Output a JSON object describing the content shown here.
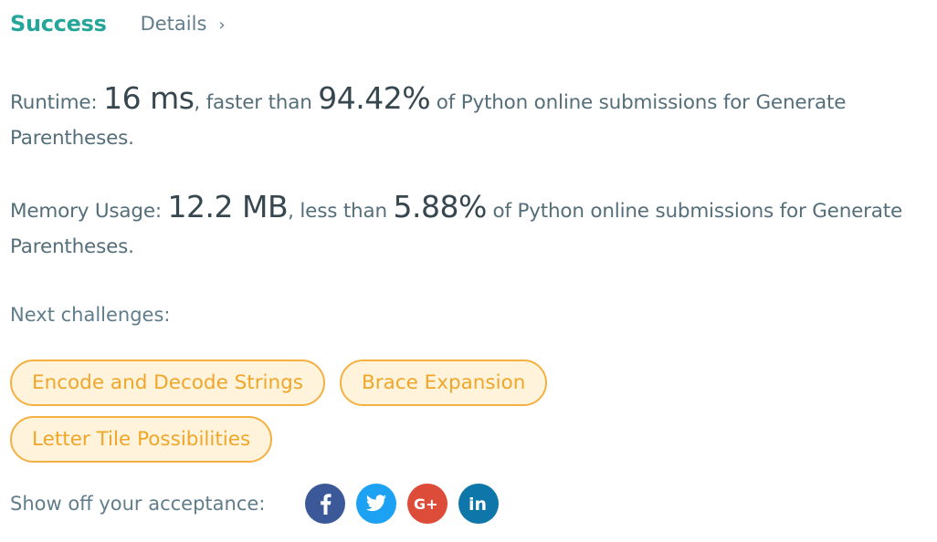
{
  "header": {
    "status": "Success",
    "details_label": "Details",
    "chevron": "›"
  },
  "runtime": {
    "label": "Runtime: ",
    "value": "16 ms",
    "mid": ", faster than ",
    "percent": "94.42%",
    "tail": " of Python online submissions for Generate Parentheses."
  },
  "memory": {
    "label": "Memory Usage: ",
    "value": "12.2 MB",
    "mid": ", less than ",
    "percent": "5.88%",
    "tail": " of Python online submissions for Generate Parentheses."
  },
  "next": {
    "label": "Next challenges:",
    "items": [
      "Encode and Decode Strings",
      "Brace Expansion",
      "Letter Tile Possibilities"
    ]
  },
  "share": {
    "label": "Show off your acceptance:",
    "icons": [
      {
        "name": "facebook-icon",
        "color": "#3b5998",
        "glyph": "f"
      },
      {
        "name": "twitter-icon",
        "color": "#1da1f2",
        "glyph": "bird"
      },
      {
        "name": "google-plus-icon",
        "color": "#dd4b39",
        "glyph": "G+"
      },
      {
        "name": "linkedin-icon",
        "color": "#0e76a8",
        "glyph": "in"
      }
    ]
  }
}
